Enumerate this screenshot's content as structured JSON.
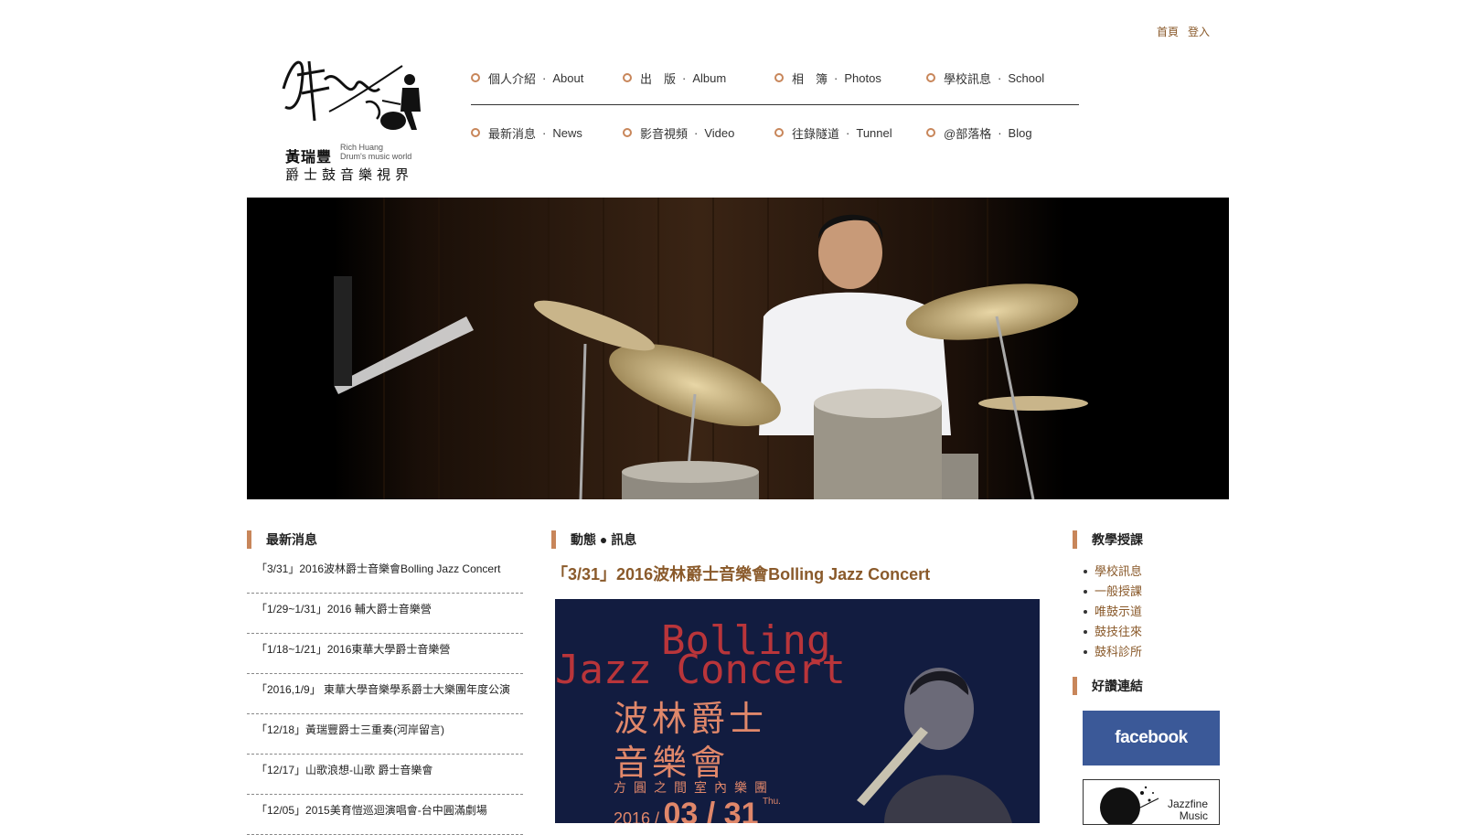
{
  "top_links": [
    "首頁",
    "登入"
  ],
  "logo": {
    "name_zh": "黃瑞豐",
    "name_en_1": "Rich Huang",
    "name_en_2": "Drum's music world",
    "tagline": "爵士鼓音樂視界"
  },
  "nav": {
    "row1": [
      {
        "zh": "個人介紹",
        "en": "About"
      },
      {
        "zh": "出　版",
        "en": "Album"
      },
      {
        "zh": "相　簿",
        "en": "Photos"
      },
      {
        "zh": "學校訊息",
        "en": "School"
      }
    ],
    "row2": [
      {
        "zh": "最新消息",
        "en": "News"
      },
      {
        "zh": "影音視頻",
        "en": "Video"
      },
      {
        "zh": "往錄隧道",
        "en": "Tunnel"
      },
      {
        "zh": "@部落格",
        "en": "Blog"
      }
    ],
    "separator": "·"
  },
  "left": {
    "heading": "最新消息",
    "items": [
      "「3/31」2016波林爵士音樂會Bolling Jazz Concert",
      "「1/29~1/31」2016 輔大爵士音樂營",
      "「1/18~1/21」2016東華大學爵士音樂營",
      "「2016,1/9」 東華大學音樂學系爵士大樂團年度公演",
      "「12/18」黃瑞豐爵士三重奏(河岸留言)",
      "「12/17」山歌浪想-山歌 爵士音樂會",
      "「12/05」2015美育愷巡迴演唱會-台中圓滿劇場"
    ]
  },
  "center": {
    "heading": "動態 ● 訊息",
    "article_title": "「3/31」2016波林爵士音樂會Bolling Jazz Concert",
    "poster": {
      "en_line1": "Bolling",
      "en_line2": "Jazz Concert",
      "zh_line1": "波林爵士",
      "zh_line2": "音樂會",
      "subtitle": "方圓之間室內樂團",
      "year": "2016 /",
      "date": "03 / 31",
      "dow": "Thu."
    }
  },
  "right": {
    "heading": "教學授課",
    "items": [
      "學校訊息",
      "一般授課",
      "唯鼓示道",
      "鼓技往來",
      "鼓科診所"
    ],
    "links_heading": "好讚連結",
    "facebook": "facebook",
    "jazzfine_1": "Jazzfine",
    "jazzfine_2": "Music"
  },
  "colors": {
    "accent": "#c8865a",
    "link_brown": "#8a5a2b",
    "facebook_blue": "#3b5998"
  }
}
